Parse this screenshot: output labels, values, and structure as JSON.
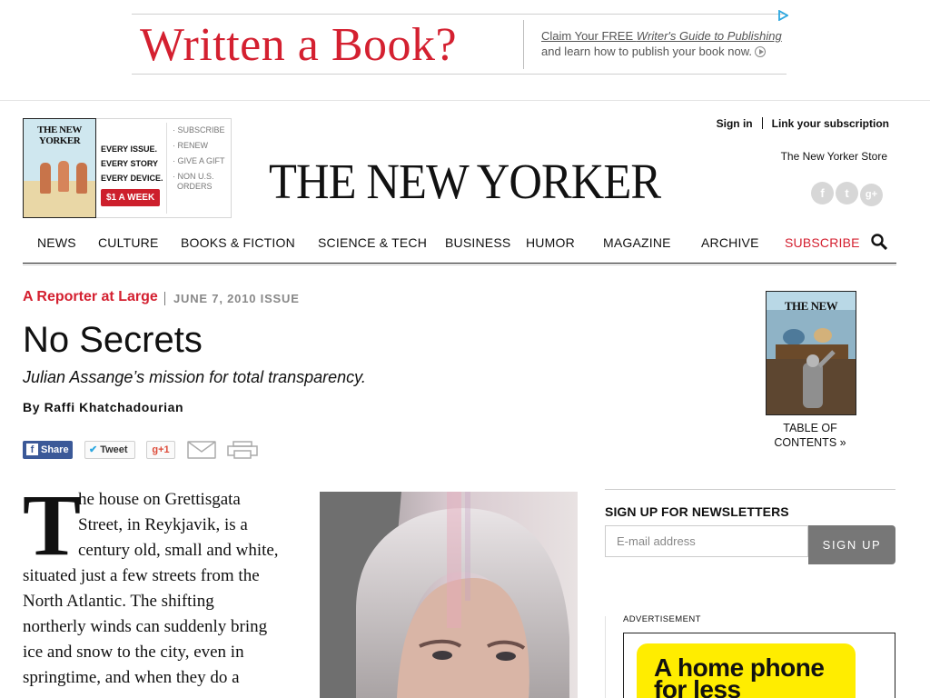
{
  "ad_top": {
    "headline": "Written a Book?",
    "claim_prefix": "Claim Your FREE ",
    "claim_italic": "Writer's Guide to Publishing",
    "learn": "and learn how to publish your book now."
  },
  "promo": {
    "cover_masthead": "THE NEW YORKER",
    "line1": "EVERY ISSUE.",
    "line2": "EVERY STORY",
    "line3": "EVERY DEVICE.",
    "price_button": "$1 A WEEK",
    "links": [
      "· SUBSCRIBE",
      "· RENEW",
      "· GIVE A GIFT",
      "· NON U.S.",
      "  ORDERS"
    ]
  },
  "header": {
    "masthead": "THE NEW YORKER",
    "sign_in": "Sign in",
    "link_subscription": "Link your subscription",
    "store": "The New Yorker Store",
    "social": [
      {
        "icon": "facebook-icon",
        "glyph": "f"
      },
      {
        "icon": "twitter-icon",
        "glyph": "t"
      },
      {
        "icon": "google-plus-icon",
        "glyph": "g+"
      }
    ]
  },
  "nav": {
    "items": [
      "NEWS",
      "CULTURE",
      "BOOKS & FICTION",
      "SCIENCE & TECH",
      "BUSINESS",
      "HUMOR",
      "MAGAZINE",
      "ARCHIVE",
      "SUBSCRIBE"
    ],
    "subscribe_color": "#d42030"
  },
  "article": {
    "rubric": "A Reporter at Large",
    "issue": "JUNE 7, 2010 ISSUE",
    "title": "No Secrets",
    "dek": "Julian Assange’s mission for total transparency.",
    "byline": "By Raffi Khatchadourian",
    "dropcap": "T",
    "body_lines": [
      "he house on Grettisgata",
      "Street, in Reykjavik, is a",
      "century old, small and white,",
      "situated just a few streets from the",
      "North Atlantic. The shifting",
      "northerly winds can suddenly bring",
      "ice and snow to the city, even in",
      "springtime, and when they do a"
    ]
  },
  "share": {
    "facebook": "Share",
    "twitter": "Tweet",
    "gplus": "+1"
  },
  "issue_cover": {
    "masthead": "THE NEW YORKER",
    "toc_line1": "TABLE OF",
    "toc_line2": "CONTENTS »"
  },
  "newsletter": {
    "title": "SIGN UP FOR NEWSLETTERS",
    "placeholder": "E-mail address",
    "button": "SIGN UP"
  },
  "advertisement": {
    "label": "ADVERTISEMENT",
    "text1": "A home phone",
    "text2": "for less"
  },
  "colors": {
    "accent_red": "#d42030",
    "facebook_blue": "#3b5998",
    "ad_yellow": "#ffed00"
  }
}
